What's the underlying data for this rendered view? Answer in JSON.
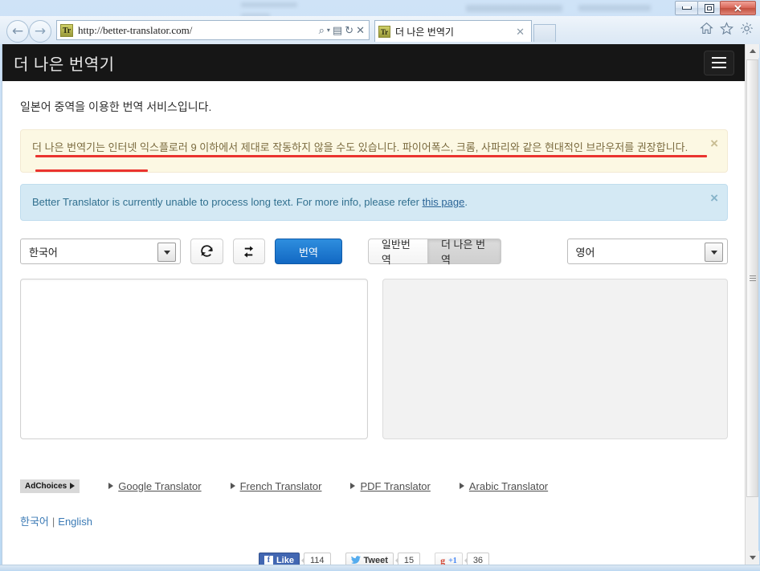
{
  "window": {
    "controls": {
      "minimize": "minimize",
      "maximize": "maximize",
      "close": "✕"
    }
  },
  "browser": {
    "back_glyph": "←",
    "forward_glyph": "→",
    "address": {
      "favicon_label": "Tr",
      "url": "http://better-translator.com/",
      "search_icon": "⌕",
      "caret": "▾",
      "compat_icon": "▤",
      "refresh_icon": "↻",
      "stop_icon": "✕"
    },
    "tab": {
      "favicon_label": "Tr",
      "title": "더 나은 번역기",
      "close": "✕"
    },
    "toolbar_icons": [
      "home-icon",
      "favorites-star-icon",
      "settings-gear-icon"
    ]
  },
  "page": {
    "header": {
      "brand": "더 나은 번역기",
      "menu_toggle": "menu-toggle"
    },
    "intro": "일본어 중역을 이용한 번역 서비스입니다.",
    "alerts": [
      {
        "id": "warning",
        "text": "더 나은 번역기는 인터넷 익스플로러 9 이하에서 제대로 작동하지 않을 수도 있습니다. 파이어폭스, 크롬, 사파리와 같은 현대적인 브라우저를 권장합니다.",
        "close": "×",
        "bg": "#fcf8e3",
        "annotation_color": "#e8231f"
      },
      {
        "id": "info",
        "text_before": "Better Translator is currently unable to process long text. For more info, please refer ",
        "link_text": "this page",
        "text_after": ".",
        "close": "×",
        "bg": "#d4e9f4"
      }
    ],
    "controls": {
      "source_language": "한국어",
      "target_language": "영어",
      "refresh_button": "refresh-icon",
      "swap_button": "swap-icon",
      "translate_button": "번역",
      "translate_button_color": "#1268c3",
      "modes": [
        {
          "label": "일반번역",
          "active": false
        },
        {
          "label": "더 나은 번역",
          "active": true
        }
      ]
    },
    "panels": {
      "source_text": "",
      "target_text": ""
    },
    "ads": {
      "adchoices_label": "AdChoices",
      "links": [
        "Google Translator",
        "French Translator",
        "PDF Translator",
        "Arabic Translator"
      ]
    },
    "language_switch": {
      "korean": "한국어",
      "separator": "|",
      "english": "English"
    },
    "social": {
      "facebook": {
        "label": "Like",
        "count": "114",
        "glyph": "f"
      },
      "twitter": {
        "label": "Tweet",
        "count": "15",
        "glyph": "🐦"
      },
      "google": {
        "label": "+1",
        "count": "36",
        "glyph": "g"
      }
    }
  },
  "scrollbar": {
    "up_arrow": "scroll-up",
    "down_arrow": "scroll-down"
  }
}
